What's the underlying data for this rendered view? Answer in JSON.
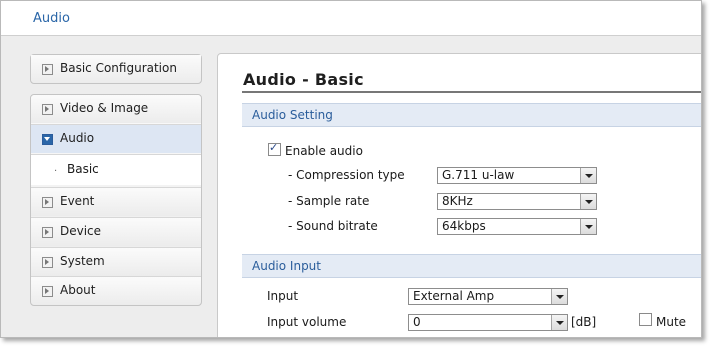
{
  "window": {
    "title": "Audio"
  },
  "sidebar": {
    "top_item": {
      "label": "Basic Configuration"
    },
    "items": [
      {
        "label": "Video & Image"
      },
      {
        "label": "Audio"
      },
      {
        "label": "Event"
      },
      {
        "label": "Device"
      },
      {
        "label": "System"
      },
      {
        "label": "About"
      }
    ],
    "sub_items": [
      {
        "label": "Basic"
      }
    ]
  },
  "main": {
    "title": "Audio - Basic",
    "audio_setting": {
      "header": "Audio Setting",
      "enable_audio": {
        "label": "Enable audio",
        "checked": true
      },
      "compression_type": {
        "label": "- Compression type",
        "value": "G.711 u-law"
      },
      "sample_rate": {
        "label": "- Sample rate",
        "value": "8KHz"
      },
      "sound_bitrate": {
        "label": "- Sound bitrate",
        "value": "64kbps"
      }
    },
    "audio_input": {
      "header": "Audio Input",
      "input": {
        "label": "Input",
        "value": "External Amp"
      },
      "input_volume": {
        "label": "Input volume",
        "value": "0",
        "unit": "[dB]"
      },
      "mute": {
        "label": "Mute",
        "checked": false
      }
    }
  },
  "colors": {
    "accent": "#2a66a8",
    "section_bg": "#e4ebf5"
  }
}
